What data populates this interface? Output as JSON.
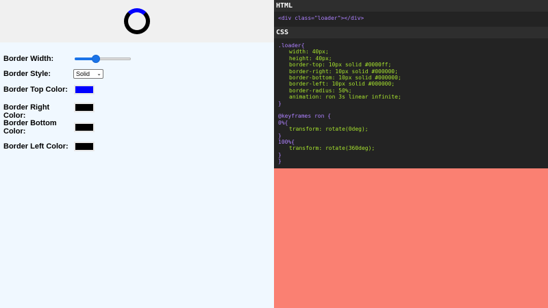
{
  "preview": {
    "border_width_px": 6,
    "colors": {
      "top": "#0000ff",
      "right": "#000000",
      "bottom": "#000000",
      "left": "#000000"
    }
  },
  "controls": {
    "border_width_label": "Border Width:",
    "border_width_value_fraction": 0.35,
    "border_style_label": "Border Style:",
    "border_style_selected": "Solid",
    "border_top_color_label": "Border Top Color:",
    "border_top_color": "#0000ff",
    "border_right_color_label": "Border Right Color:",
    "border_right_color": "#000000",
    "border_bottom_color_label": "Border Bottom Color:",
    "border_bottom_color": "#000000",
    "border_left_color_label": "Border Left Color:",
    "border_left_color": "#000000"
  },
  "code": {
    "html_header": "HTML",
    "html_line": "<div class=\"loader\"></div>",
    "css_header": "CSS",
    "css_lines": [
      ".loader{",
      "width: 40px;",
      "height: 40px;",
      "border-top: 10px solid #0000ff;",
      "border-right: 10px solid #000000;",
      "border-bottom: 10px solid #000000;",
      "border-left: 10px solid #000000;",
      "border-radius: 50%;",
      "animation: ron 3s linear infinite;",
      "}",
      "",
      "@keyframes ron {",
      "0%{",
      "transform: rotate(0deg);",
      "}",
      "100%{",
      "transform: rotate(360deg);",
      "}",
      "}"
    ]
  }
}
